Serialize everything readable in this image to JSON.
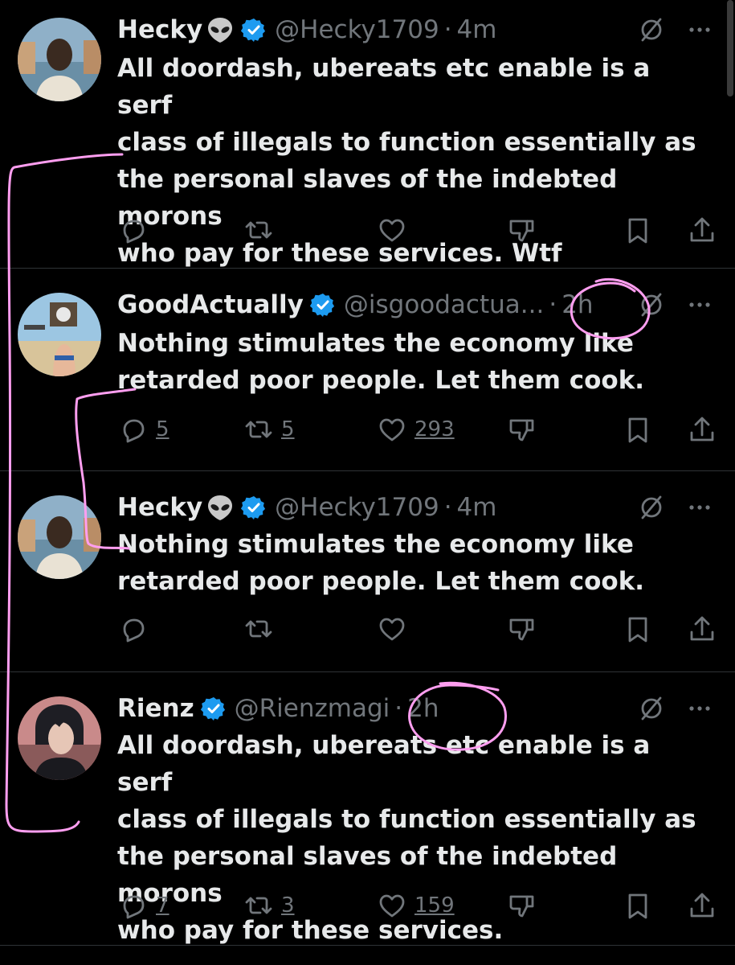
{
  "colors": {
    "background": "#000000",
    "text": "#e7e9ea",
    "muted": "#71767b",
    "verified": "#1d9bf0",
    "annotation": "#ff9ef0",
    "divider": "#2f3336"
  },
  "icons": {
    "reply": "reply-icon",
    "retweet": "retweet-icon",
    "like": "heart-icon",
    "dislike": "dislike-icon",
    "bookmark": "bookmark-icon",
    "share": "share-icon",
    "grok": "grok-icon",
    "more": "more-icon"
  },
  "tweets": [
    {
      "name": "Hecky",
      "emoji": "alien-emoji",
      "handle": "@Hecky1709",
      "time": "4m",
      "text": "All doordash, ubereats etc enable is a serf\nclass of illegals to function essentially as\nthe personal slaves of the indebted morons\nwho pay for these services. Wtf",
      "replies": "",
      "retweets": "",
      "likes": ""
    },
    {
      "name": "GoodActually",
      "handle": "@isgoodactua...",
      "time": "2h",
      "text": "Nothing stimulates the economy like\nretarded poor people. Let them cook.",
      "replies": "5",
      "retweets": "5",
      "likes": "293"
    },
    {
      "name": "Hecky",
      "emoji": "alien-emoji",
      "handle": "@Hecky1709",
      "time": "4m",
      "text": "Nothing stimulates the economy like\nretarded poor people. Let them cook.",
      "replies": "",
      "retweets": "",
      "likes": ""
    },
    {
      "name": "Rienz",
      "handle": "@Rienzmagi",
      "time": "2h",
      "text": "All doordash, ubereats etc enable is a serf\nclass of illegals to function essentially as\nthe personal slaves of the indebted morons\nwho pay for these services.",
      "replies": "7",
      "retweets": "3",
      "likes": "159"
    }
  ]
}
